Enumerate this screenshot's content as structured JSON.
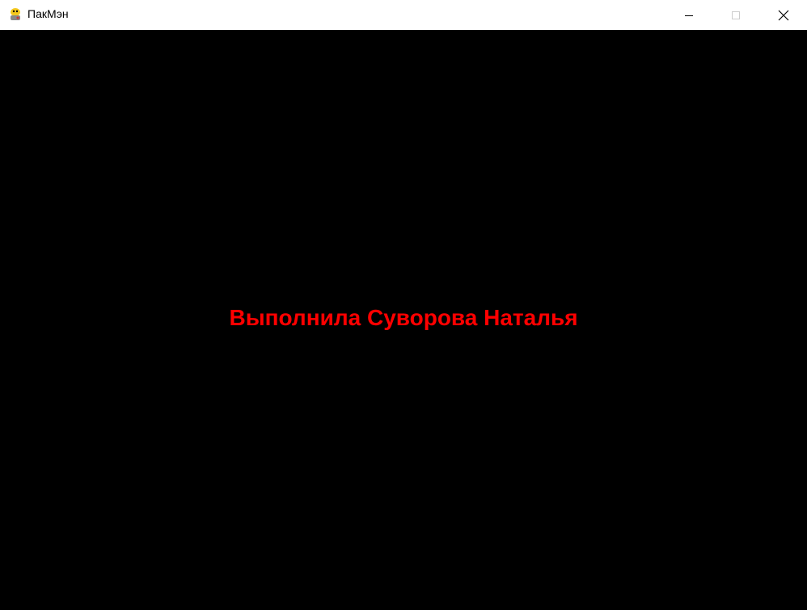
{
  "window": {
    "title": "ПакМэн",
    "icon": "python-snake-icon"
  },
  "controls": {
    "minimize": "minimize-icon",
    "maximize": "maximize-icon",
    "close": "close-icon"
  },
  "game": {
    "caption": "Выполнила Суворова Наталья",
    "caption_color": "#ff0000",
    "background": "#000000"
  }
}
